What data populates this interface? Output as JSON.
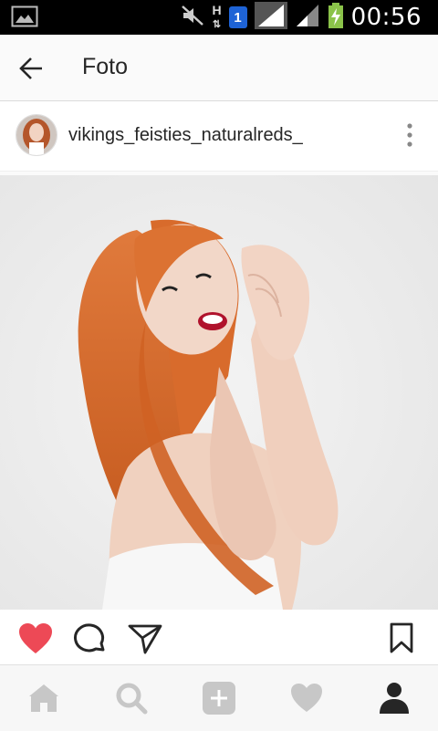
{
  "statusbar": {
    "time": "00:56",
    "sim_label": "1",
    "network_type": "H",
    "icons": [
      "image-notification-icon",
      "mute-icon",
      "network-type-icon",
      "sim-icon",
      "signal-icon",
      "signal-icon",
      "battery-charging-icon"
    ]
  },
  "appbar": {
    "title": "Foto",
    "back_icon": "arrow-left-icon"
  },
  "post": {
    "username": "vikings_feisties_naturalreds_",
    "menu_icon": "more-vertical-icon",
    "actions": {
      "like_icon": "heart-filled-icon",
      "comment_icon": "comment-bubble-icon",
      "share_icon": "paper-plane-icon",
      "save_icon": "bookmark-icon",
      "like_color": "#ed4956"
    }
  },
  "bottom_nav": {
    "items": [
      "home-icon",
      "search-icon",
      "add-icon",
      "heart-icon",
      "profile-icon"
    ]
  }
}
